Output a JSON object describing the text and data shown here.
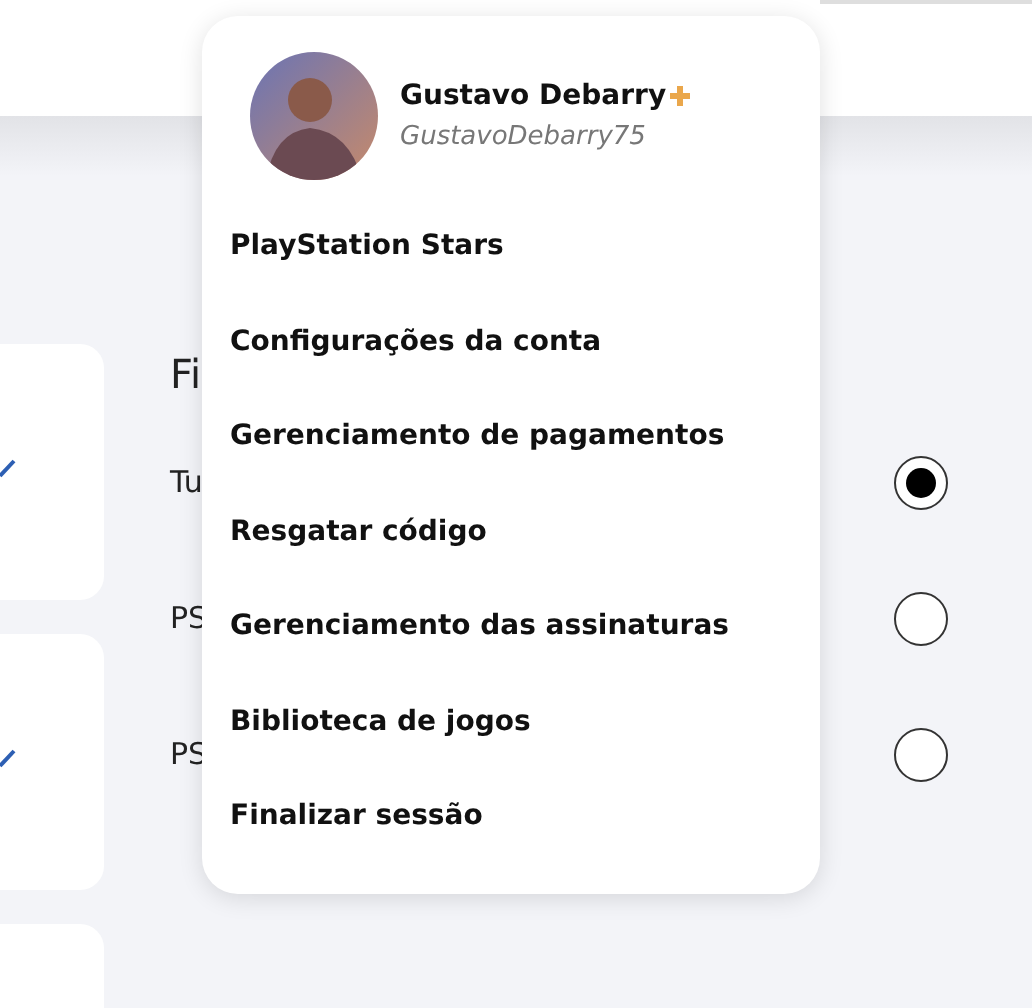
{
  "background": {
    "heading": "Fi",
    "options": [
      {
        "label": "Tu",
        "selected": true
      },
      {
        "label": "PS",
        "selected": false
      },
      {
        "label": "PS",
        "selected": false
      }
    ],
    "cards": [
      {
        "checked": true
      },
      {
        "checked": true
      }
    ]
  },
  "account_menu": {
    "name": "Gustavo Debarry",
    "handle": "GustavoDebarry75",
    "plus_member": true,
    "items": [
      "PlayStation Stars",
      "Configurações da conta",
      "Gerenciamento de pagamentos",
      "Resgatar código",
      "Gerenciamento das assinaturas",
      "Biblioteca de jogos",
      "Finalizar sessão"
    ]
  }
}
